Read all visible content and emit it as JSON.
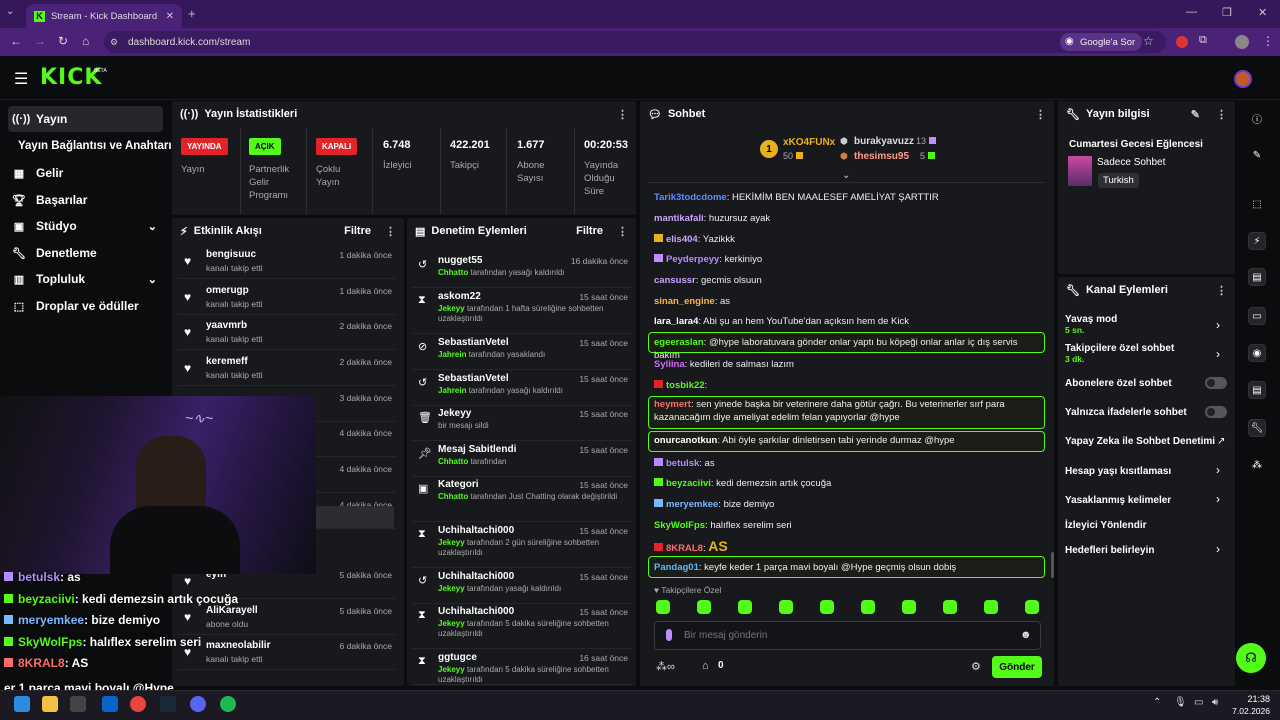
{
  "browser": {
    "tab_title": "Stream - Kick Dashboard",
    "url": "dashboard.kick.com/stream",
    "google_button": "Google'a Sor"
  },
  "brand": {
    "logo": "KICK",
    "beta": "BETA",
    "accent": "#53fc18"
  },
  "sidebar": {
    "items": [
      {
        "icon": "broadcast-icon",
        "label": "Yayın"
      },
      {
        "icon": "",
        "label": "Yayın Bağlantısı ve Anahtarı"
      },
      {
        "icon": "revenue-icon",
        "label": "Gelir"
      },
      {
        "icon": "trophy-icon",
        "label": "Başarılar"
      },
      {
        "icon": "studio-icon",
        "label": "Stüdyo"
      },
      {
        "icon": "wrench-icon",
        "label": "Denetleme"
      },
      {
        "icon": "community-icon",
        "label": "Topluluk"
      },
      {
        "icon": "drops-icon",
        "label": "Droplar ve ödüller"
      }
    ]
  },
  "stats": {
    "title": "Yayın İstatistikleri",
    "live_badge": "YAYINDA",
    "live_label": "Yayın",
    "partner_badge": "AÇIK",
    "partner_label": [
      "Partnerlik",
      "Gelir",
      "Programı"
    ],
    "multi_badge": "KAPALI",
    "multi_label": [
      "Çoklu",
      "Yayın"
    ],
    "viewers_value": "6.748",
    "viewers_label": "İzleyici",
    "followers_value": "422.201",
    "followers_label": "Takipçi",
    "subs_value": "1.677",
    "subs_label": [
      "Abone",
      "Sayısı"
    ],
    "uptime_value": "00:20:53",
    "uptime_label": [
      "Yayında",
      "Olduğu",
      "Süre"
    ]
  },
  "activity": {
    "title": "Etkinlik Akışı",
    "filter": "Filtre",
    "items": [
      {
        "name": "bengisuuc",
        "sub": "kanalı takip etti",
        "time": "1 dakika önce"
      },
      {
        "name": "omerugp",
        "sub": "kanalı takip etti",
        "time": "1 dakika önce"
      },
      {
        "name": "yaavmrb",
        "sub": "kanalı takip etti",
        "time": "2 dakika önce"
      },
      {
        "name": "keremeff",
        "sub": "kanalı takip etti",
        "time": "2 dakika önce"
      },
      {
        "name": "",
        "sub": "",
        "time": "3 dakika önce"
      },
      {
        "name": "",
        "sub": "",
        "time": "4 dakika önce"
      },
      {
        "name": "",
        "sub": ": Toplam abonelik",
        "time": "4 dakika önce"
      },
      {
        "name": "",
        "sub": "",
        "time": "4 dakika önce"
      },
      {
        "name": "eyiff",
        "sub": "",
        "time": "5 dakika önce"
      },
      {
        "name": "AliKarayell",
        "sub": "abone oldu",
        "time": "5 dakika önce"
      },
      {
        "name": "maxneolabilir",
        "sub": "kanalı takip etti",
        "time": "6 dakika önce"
      }
    ]
  },
  "moderation": {
    "title": "Denetim Eylemleri",
    "filter": "Filtre",
    "items": [
      {
        "icon": "undo-icon",
        "name": "nugget55",
        "by": "Chhatto",
        "sub": "tarafından yasağı kaldırıldı",
        "time": "16 dakika önce"
      },
      {
        "icon": "hourglass-icon",
        "name": "askom22",
        "by": "Jekeyy",
        "sub": "tarafından 1 hafta süreliğine sohbetten uzaklaştırıldı",
        "time": "15 saat önce"
      },
      {
        "icon": "ban-icon",
        "name": "SebastianVetel",
        "by": "Jahrein",
        "sub": "tarafından yasaklandı",
        "time": "15 saat önce"
      },
      {
        "icon": "undo-icon",
        "name": "SebastianVetel",
        "by": "Jahrein",
        "sub": "tarafından yasağı kaldırıldı",
        "time": "15 saat önce"
      },
      {
        "icon": "trash-icon",
        "name": "Jekeyy",
        "by": "",
        "sub": "bir mesajı sildi",
        "time": "15 saat önce"
      },
      {
        "icon": "pin-icon",
        "name": "Mesaj Sabitlendi",
        "by": "Chhatto",
        "sub": "tarafından",
        "time": "15 saat önce"
      },
      {
        "icon": "category-icon",
        "name": "Kategori",
        "by": "Chhatto",
        "sub": "tarafından Just Chatting olarak değiştirildi",
        "time": "15 saat önce"
      },
      {
        "icon": "hourglass-icon",
        "name": "Uchihaltachi000",
        "by": "Jekeyy",
        "sub": "tarafından 2 gün süreliğine sohbetten uzaklaştırıldı",
        "time": "15 saat önce"
      },
      {
        "icon": "undo-icon",
        "name": "Uchihaltachi000",
        "by": "Jekeyy",
        "sub": "tarafından yasağı kaldırıldı",
        "time": "15 saat önce"
      },
      {
        "icon": "hourglass-icon",
        "name": "Uchihaltachi000",
        "by": "Jekeyy",
        "sub": "tarafından 5 dakika süreliğine sohbetten uzaklaştırıldı",
        "time": "15 saat önce"
      },
      {
        "icon": "hourglass-icon",
        "name": "ggtugce",
        "by": "Jekeyy",
        "sub": "tarafından 5 dakika süreliğine sohbetten uzaklaştırıldı",
        "time": "16 saat önce"
      }
    ]
  },
  "chat": {
    "title": "Sohbet",
    "leader": {
      "rank": "1",
      "name": "xKO4FUNx",
      "count": "50"
    },
    "top2": {
      "name": "burakyavuzz",
      "count": "13"
    },
    "top3": {
      "name": "thesimsu95",
      "count": "5"
    },
    "messages": [
      {
        "user": "Tarik3todcdome",
        "color": "#5b8cff",
        "text": "HEKİMİM BEN MAALESEF AMELİYAT ŞARTTIR",
        "hl": false
      },
      {
        "user": "mantikafali",
        "color": "#c9a3ff",
        "text": "huzursuz ayak",
        "hl": false
      },
      {
        "user": "elis404",
        "color": "#c9a3ff",
        "text": "Yazikkk",
        "hl": false
      },
      {
        "user": "Peyderpeyy",
        "color": "#b48cff",
        "text": "kerkiniyo",
        "hl": false
      },
      {
        "user": "cansussr",
        "color": "#c9a3ff",
        "text": "gecmis olsuun",
        "hl": false
      },
      {
        "user": "sinan_engine",
        "color": "#ffb347",
        "text": "as",
        "hl": false
      },
      {
        "user": "lara_lara4",
        "color": "#ffffff",
        "text": "Abi şu an hem YouTube'dan açıksın hem de Kick",
        "hl": false
      },
      {
        "user": "egeeraslan",
        "color": "#53fc18",
        "text": "@hype laboratuvara gönder onlar yaptı bu köpeği onlar anlar iç dış servis bakım",
        "hl": true
      },
      {
        "user": "Syliina",
        "color": "#d36bff",
        "text": "kedileri de salması lazım",
        "hl": false
      },
      {
        "user": "tosbik22",
        "color": "#53fc18",
        "text": "",
        "hl": false
      },
      {
        "user": "heymert",
        "color": "#ff6b6b",
        "text": "sen yinede başka bir veterinere daha götür çağrı. Bu veterinerler sırf para kazanacağım diye ameliyat edelim felan yapıyorlar @hype",
        "hl": true
      },
      {
        "user": "onurcanotkun",
        "color": "#ffffff",
        "text": "Abi öyle şarkılar dinletirsen tabi yerinde durmaz @hype",
        "hl": true
      },
      {
        "user": "betulsk",
        "color": "#b48cff",
        "text": "as",
        "hl": false
      },
      {
        "user": "beyzaciivi",
        "color": "#53fc18",
        "text": "kedi demezsin artık çocuğa",
        "hl": false
      },
      {
        "user": "meryemkee",
        "color": "#7ab8ff",
        "text": "bize demiyo",
        "hl": false
      },
      {
        "user": "SkyWolFps",
        "color": "#53fc18",
        "text": "halıflex serelim seri",
        "hl": false
      },
      {
        "user": "8KRAL8",
        "color": "#ff6b6b",
        "text": "AS",
        "hl": false
      },
      {
        "user": "Pandag01",
        "color": "#5bb8ff",
        "text": "keyfe keder 1 parça mavi boyalı @Hype geçmiş olsun dobiş",
        "hl": true
      }
    ],
    "followers_only": "Takipçilere Özel",
    "placeholder": "Bir mesaj gönderin",
    "points": "0",
    "send": "Gönder"
  },
  "stream_info": {
    "title": "Yayın bilgisi",
    "stream_title": "Cumartesi Gecesi Eğlencesi",
    "category": "Sadece Sohbet",
    "language": "Turkish"
  },
  "channel_actions": {
    "title": "Kanal Eylemleri",
    "items": [
      {
        "label": "Yavaş mod",
        "sub": "5 sn."
      },
      {
        "label": "Takipçilere özel sohbet",
        "sub": "3 dk."
      },
      {
        "label": "Abonelere özel sohbet",
        "sub": ""
      },
      {
        "label": "Yalnızca ifadelerle sohbet",
        "sub": ""
      },
      {
        "label": "Yapay Zeka ile Sohbet Denetimi",
        "sub": ""
      },
      {
        "label": "Hesap yaşı kısıtlaması",
        "sub": ""
      },
      {
        "label": "Yasaklanmış kelimeler",
        "sub": ""
      },
      {
        "label": "İzleyici Yönlendir",
        "sub": ""
      },
      {
        "label": "Hedefleri belirleyin",
        "sub": ""
      }
    ]
  },
  "overlay": {
    "lines": [
      {
        "user": "betulsk",
        "text": ": as",
        "color": "#b48cff"
      },
      {
        "user": "beyzaciivi",
        "text": ": kedi demezsin artık çocuğa",
        "color": "#53fc18"
      },
      {
        "user": "meryemkee",
        "text": ": bize demiyo",
        "color": "#7ab8ff"
      },
      {
        "user": "SkyWolFps",
        "text": ": halıflex serelim seri",
        "color": "#53fc18"
      },
      {
        "user": "8KRAL8",
        "text": ": AS",
        "color": "#ff6b6b"
      },
      {
        "user": "",
        "text": "er 1 parça mavi boyalı @Hype",
        "color": "#ffffff"
      }
    ]
  },
  "taskbar": {
    "time": "21:38",
    "date": "7.02.2026"
  }
}
